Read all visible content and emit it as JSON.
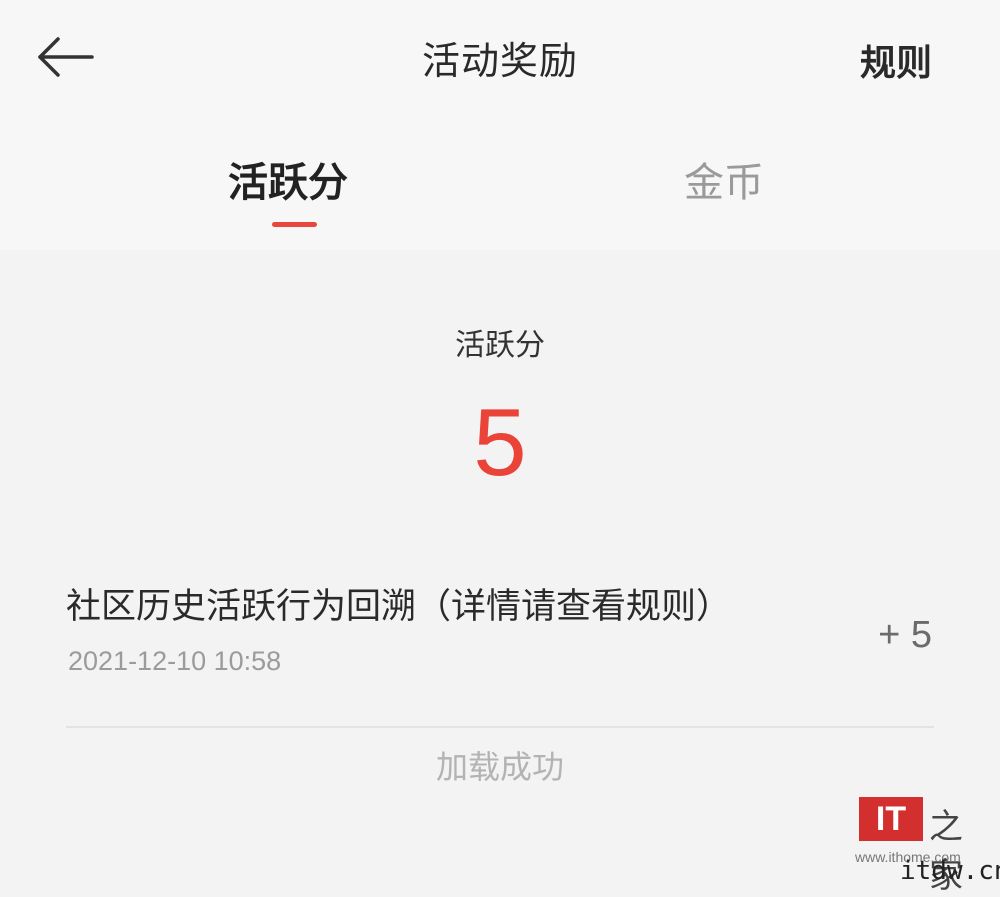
{
  "header": {
    "title": "活动奖励",
    "rules_label": "规则",
    "back_icon": "arrow-left-icon"
  },
  "tabs": [
    {
      "label": "活跃分",
      "active": true
    },
    {
      "label": "金币",
      "active": false
    }
  ],
  "score": {
    "label": "活跃分",
    "value": "5"
  },
  "records": [
    {
      "title": "社区历史活跃行为回溯（详情请查看规则）",
      "time": "2021-12-10 10:58",
      "points": "+ 5"
    }
  ],
  "load_status": "加载成功",
  "watermark": {
    "logo_text": "IT",
    "seal_text": "之家",
    "site": "www.ithome.com",
    "corner_text": "itdw.cn"
  },
  "colors": {
    "accent": "#ea4439",
    "background": "#f3f3f3",
    "header_bg": "#f7f7f7"
  }
}
